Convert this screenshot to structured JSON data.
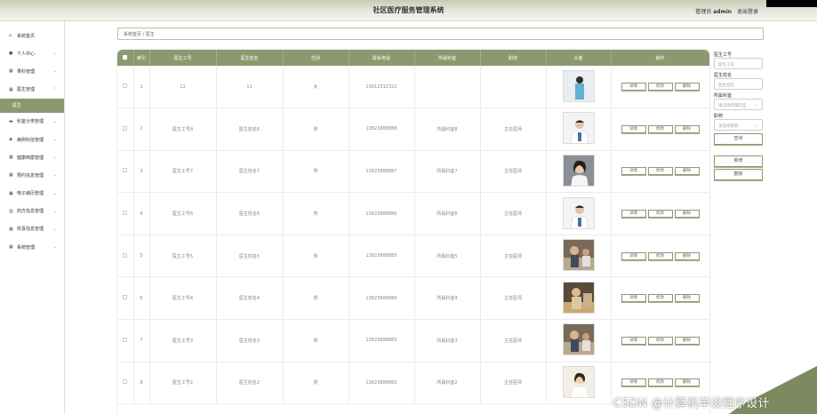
{
  "header": {
    "title": "社区医疗服务管理系统",
    "user_label": "管理员",
    "user_name": "admin",
    "logout": "退出登录"
  },
  "sidebar": {
    "items": [
      {
        "icon": "home-icon",
        "glyph": "⌂",
        "label": "系统首页",
        "arrow": ""
      },
      {
        "icon": "user-icon",
        "glyph": "●",
        "label": "个人中心",
        "arrow": "⌄"
      },
      {
        "icon": "grid-icon",
        "glyph": "▦",
        "label": "果科管理",
        "arrow": "⌄"
      },
      {
        "icon": "grid-icon",
        "glyph": "▦",
        "label": "医生管理",
        "arrow": "⌃"
      },
      {
        "icon": "folder-icon",
        "glyph": "▬",
        "label": "科室分类管理",
        "arrow": "⌄"
      },
      {
        "icon": "people-icon",
        "glyph": "♟",
        "label": "病例科信管理",
        "arrow": "⌄"
      },
      {
        "icon": "grid-icon",
        "glyph": "▦",
        "label": "健康档案管理",
        "arrow": "⌄"
      },
      {
        "icon": "grid-icon",
        "glyph": "▦",
        "label": "预约信息管理",
        "arrow": "⌄"
      },
      {
        "icon": "book-icon",
        "glyph": "▣",
        "label": "电子病历管理",
        "arrow": "⌄"
      },
      {
        "icon": "chart-icon",
        "glyph": "▥",
        "label": "药方信息管理",
        "arrow": "⌄"
      },
      {
        "icon": "grid-icon",
        "glyph": "▦",
        "label": "欢喜信息管理",
        "arrow": "⌄"
      },
      {
        "icon": "grid-icon",
        "glyph": "▦",
        "label": "系统管理",
        "arrow": "⌄"
      }
    ],
    "active_sub": "医生"
  },
  "breadcrumb": {
    "home": "系统首页",
    "sep": "/",
    "current": "医生"
  },
  "table": {
    "headers": [
      "索引",
      "医生工号",
      "医生姓名",
      "性别",
      "联系电话",
      "所属科室",
      "职称",
      "头像",
      "操作"
    ],
    "actions": {
      "detail": "详情",
      "edit": "修改",
      "delete": "删除"
    },
    "rows": [
      {
        "index": "1",
        "id": "11",
        "name": "11",
        "gender": "女",
        "phone": "13012312322",
        "dept": "",
        "title": "",
        "photo_kind": "nurse"
      },
      {
        "index": "2",
        "id": "医生工号8",
        "name": "医生姓名8",
        "gender": "男",
        "phone": "13823888888",
        "dept": "所属科室8",
        "title": "主任医师",
        "photo_kind": "doctor"
      },
      {
        "index": "3",
        "id": "医生工号7",
        "name": "医生姓名7",
        "gender": "男",
        "phone": "13823888887",
        "dept": "所属科室7",
        "title": "主任医师",
        "photo_kind": "woman"
      },
      {
        "index": "4",
        "id": "医生工号6",
        "name": "医生姓名6",
        "gender": "男",
        "phone": "13823888886",
        "dept": "所属科室6",
        "title": "主任医师",
        "photo_kind": "doctor"
      },
      {
        "index": "5",
        "id": "医生工号5",
        "name": "医生姓名5",
        "gender": "男",
        "phone": "13823888885",
        "dept": "所属科室5",
        "title": "主任医师",
        "photo_kind": "scene"
      },
      {
        "index": "6",
        "id": "医生工号4",
        "name": "医生姓名4",
        "gender": "男",
        "phone": "13823888884",
        "dept": "所属科室4",
        "title": "主任医师",
        "photo_kind": "scene2"
      },
      {
        "index": "7",
        "id": "医生工号3",
        "name": "医生姓名3",
        "gender": "男",
        "phone": "13823888883",
        "dept": "所属科室3",
        "title": "主任医师",
        "photo_kind": "scene"
      },
      {
        "index": "8",
        "id": "医生工号2",
        "name": "医生姓名2",
        "gender": "男",
        "phone": "13823888882",
        "dept": "所属科室2",
        "title": "主任医师",
        "photo_kind": "woman2"
      }
    ]
  },
  "search": {
    "id_label": "医生工号",
    "id_placeholder": "医生工号",
    "name_label": "医生姓名",
    "name_placeholder": "医生姓名",
    "dept_label": "所属科室",
    "dept_placeholder": "请选择所属科室",
    "title_label": "职称",
    "title_placeholder": "请选择职称",
    "query_button": "查询",
    "add_button": "新增",
    "delete_button": "删除"
  },
  "watermark": "CSDN @计算机毕设程序设计",
  "colors": {
    "accent": "#8c9970",
    "topbar": "#e9ebe0"
  }
}
